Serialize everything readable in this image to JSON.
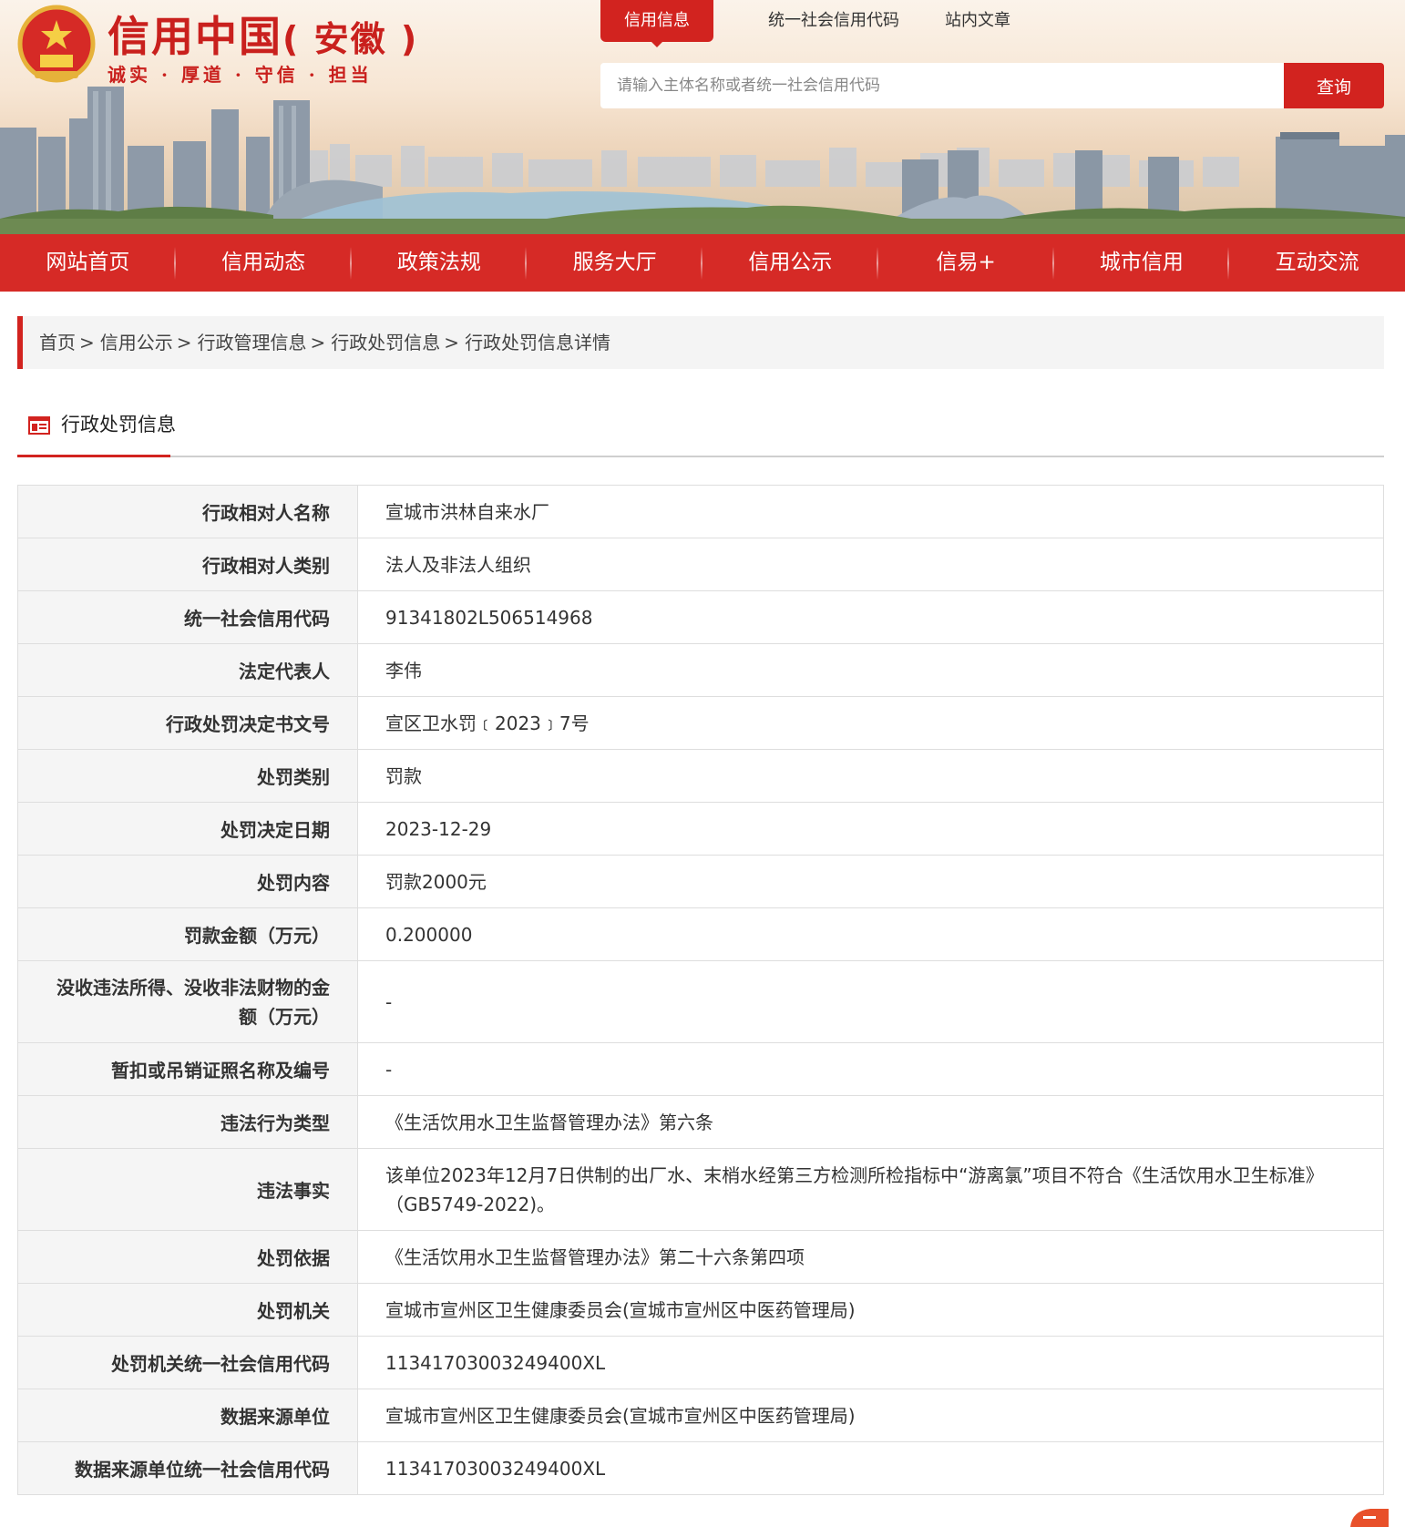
{
  "header": {
    "site_title": "信用中国",
    "site_title_region": "( 安徽 )",
    "slogan": "诚实 · 厚道 · 守信 · 担当",
    "search_tabs": [
      "信用信息",
      "统一社会信用代码",
      "站内文章"
    ],
    "search_placeholder": "请输入主体名称或者统一社会信用代码",
    "search_button": "查询"
  },
  "nav": [
    "网站首页",
    "信用动态",
    "政策法规",
    "服务大厅",
    "信用公示",
    "信易+",
    "城市信用",
    "互动交流"
  ],
  "breadcrumb": [
    "首页",
    "信用公示",
    "行政管理信息",
    "行政处罚信息",
    "行政处罚信息详情"
  ],
  "section": {
    "title": "行政处罚信息"
  },
  "rows": [
    {
      "key": "行政相对人名称",
      "value": "宣城市洪林自来水厂"
    },
    {
      "key": "行政相对人类别",
      "value": "法人及非法人组织"
    },
    {
      "key": "统一社会信用代码",
      "value": "91341802L506514968"
    },
    {
      "key": "法定代表人",
      "value": "李伟"
    },
    {
      "key": "行政处罚决定书文号",
      "value": "宣区卫水罚﹝2023﹞7号"
    },
    {
      "key": "处罚类别",
      "value": "罚款"
    },
    {
      "key": "处罚决定日期",
      "value": "2023-12-29"
    },
    {
      "key": "处罚内容",
      "value": "罚款2000元"
    },
    {
      "key": "罚款金额（万元）",
      "value": "0.200000"
    },
    {
      "key": "没收违法所得、没收非法财物的金额（万元）",
      "value": "-"
    },
    {
      "key": "暂扣或吊销证照名称及编号",
      "value": "-"
    },
    {
      "key": "违法行为类型",
      "value": "《生活饮用水卫生监督管理办法》第六条"
    },
    {
      "key": "违法事实",
      "value": "该单位2023年12月7日供制的出厂水、末梢水经第三方检测所检指标中“游离氯”项目不符合《生活饮用水卫生标准》（GB5749-2022)。"
    },
    {
      "key": "处罚依据",
      "value": "《生活饮用水卫生监督管理办法》第二十六条第四项"
    },
    {
      "key": "处罚机关",
      "value": "宣城市宣州区卫生健康委员会(宣城市宣州区中医药管理局)"
    },
    {
      "key": "处罚机关统一社会信用代码",
      "value": "11341703003249400XL"
    },
    {
      "key": "数据来源单位",
      "value": "宣城市宣州区卫生健康委员会(宣城市宣州区中医药管理局)"
    },
    {
      "key": "数据来源单位统一社会信用代码",
      "value": "11341703003249400XL"
    }
  ],
  "colors": {
    "brand_red": "#d2231f",
    "nav_red": "#d62a26"
  },
  "icons": {
    "emblem": "national-emblem-icon",
    "section": "table-icon"
  }
}
